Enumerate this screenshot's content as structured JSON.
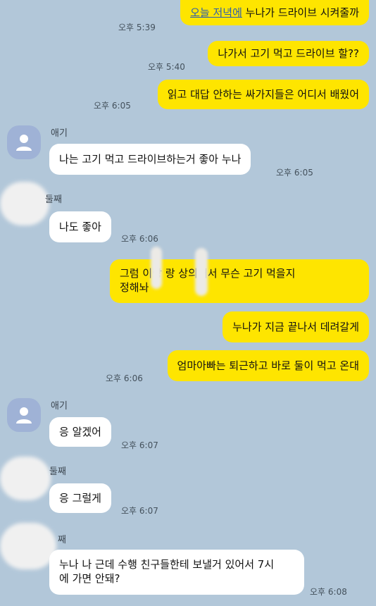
{
  "messages": {
    "m1": {
      "link_text": "오늘 저녁에",
      "text": " 누나가 드라이브 시켜줄까",
      "time": "오후 5:39"
    },
    "m2": {
      "text": "나가서 고기 먹고 드라이브 할??",
      "time": "오후 5:40"
    },
    "m3": {
      "text": "읽고 대답 안하는 싸가지들은 어디서 배웠어",
      "time": "오후 6:05"
    },
    "r1": {
      "sender": "애기",
      "text": "나는 고기 먹고 드라이브하는거 좋아 누나",
      "time": "오후 6:05"
    },
    "r2": {
      "sender": "둘째",
      "text": "나도 좋아",
      "time": "오후 6:06"
    },
    "m4": {
      "line1": "그럼   이랑   랑 상의해서 무슨 고기 먹을지",
      "line2": "정해놔"
    },
    "m5": {
      "text": "누나가 지금 끝나서 데려갈게"
    },
    "m6": {
      "text": "엄마아빠는 퇴근하고 바로 둘이 먹고 온대",
      "time": "오후 6:06"
    },
    "r3": {
      "sender": "애기",
      "text": "응 알겠어",
      "time": "오후 6:07"
    },
    "r4": {
      "sender": "둘째",
      "text": "응 그럴게",
      "time": "오후 6:07"
    },
    "r5": {
      "sender": "째",
      "line1": "누나 나 근데 수행 친구들한테 보낼거 있어서 7시",
      "line2": "에 가면 안돼?",
      "time": "오후 6:08"
    }
  },
  "icons": {
    "avatar": "person-silhouette-icon"
  },
  "colors": {
    "background": "#b2c7d9",
    "my_bubble": "#fee500",
    "their_bubble": "#ffffff"
  }
}
